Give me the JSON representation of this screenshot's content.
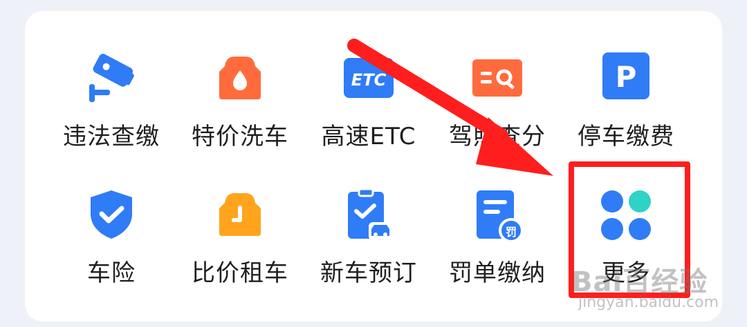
{
  "grid": {
    "row1": [
      {
        "label": "违法查缴",
        "icon": "surveillance-camera-icon",
        "color": "#2f7cf6"
      },
      {
        "label": "特价洗车",
        "icon": "car-wash-icon",
        "color": "#ff6b3d"
      },
      {
        "label": "高速ETC",
        "icon": "etc-icon",
        "color": "#2f7cf6"
      },
      {
        "label": "驾照查分",
        "icon": "license-search-icon",
        "color": "#ff6b3d"
      },
      {
        "label": "停车缴费",
        "icon": "parking-icon",
        "color": "#2f7cf6"
      }
    ],
    "row2": [
      {
        "label": "车险",
        "icon": "shield-check-icon",
        "color": "#2f7cf6"
      },
      {
        "label": "比价租车",
        "icon": "car-rental-icon",
        "color": "#ffa41c"
      },
      {
        "label": "新车预订",
        "icon": "new-car-order-icon",
        "color": "#2f7cf6"
      },
      {
        "label": "罚单缴纳",
        "icon": "fine-ticket-icon",
        "color": "#2f7cf6"
      },
      {
        "label": "更多",
        "icon": "more-dots-icon",
        "color": "#2f7cf6"
      }
    ]
  },
  "icon_texts": {
    "etc": "ETC",
    "parking": "P",
    "fine": "罚"
  },
  "watermark": {
    "logo": "Bai百经验",
    "url": "jingyan.baidu.com"
  },
  "colors": {
    "blue": "#2f7cf6",
    "orange": "#ff6b3d",
    "amber": "#ffa41c",
    "teal": "#2ed3c6",
    "annotation_red": "#ff1e1e"
  }
}
